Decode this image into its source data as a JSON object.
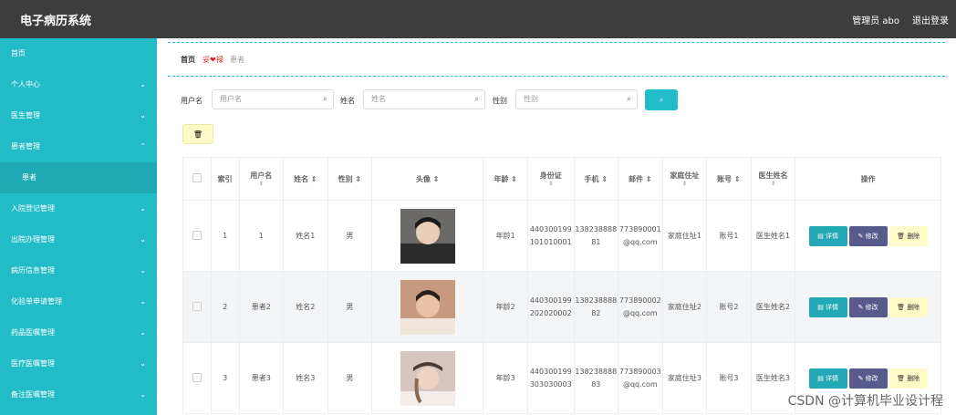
{
  "header": {
    "app_title": "电子病历系统",
    "admin_text": "管理员 abo",
    "logout_label": "退出登录"
  },
  "sidebar": {
    "items": [
      {
        "label": "首页"
      },
      {
        "label": "个人中心"
      },
      {
        "label": "医生管理"
      },
      {
        "label": "患者管理"
      },
      {
        "label": "患者"
      },
      {
        "label": "入院登记管理"
      },
      {
        "label": "出院办理管理"
      },
      {
        "label": "病历信息管理"
      },
      {
        "label": "化验单申请管理"
      },
      {
        "label": "药品医嘱管理"
      },
      {
        "label": "医疗医嘱管理"
      },
      {
        "label": "备注医嘱管理"
      }
    ]
  },
  "breadcrumb": {
    "home": "首页",
    "heart": "妥❤禄",
    "current": "患者"
  },
  "search": {
    "username_label": "用户名",
    "username_placeholder": "用户名",
    "name_label": "姓名",
    "name_placeholder": "姓名",
    "gender_label": "性别",
    "gender_placeholder": "性别"
  },
  "table": {
    "headers": {
      "index": "索引",
      "username": "用户名",
      "name": "姓名",
      "gender": "性别",
      "avatar": "头像",
      "age": "年龄",
      "idcard": "身份证",
      "phone": "手机",
      "email": "邮件",
      "address": "家庭住址",
      "account": "账号",
      "doctor": "医生姓名",
      "ops": "操作"
    },
    "rows": [
      {
        "index": "1",
        "username": "1",
        "name": "姓名1",
        "gender": "男",
        "age": "年龄1",
        "idcard": "440300199101010001",
        "phone": "13823888881",
        "email": "773890001@qq.com",
        "address": "家庭住址1",
        "account": "账号1",
        "doctor": "医生姓名1"
      },
      {
        "index": "2",
        "username": "患者2",
        "name": "姓名2",
        "gender": "男",
        "age": "年龄2",
        "idcard": "440300199202020002",
        "phone": "13823888882",
        "email": "773890002@qq.com",
        "address": "家庭住址2",
        "account": "账号2",
        "doctor": "医生姓名2"
      },
      {
        "index": "3",
        "username": "患者3",
        "name": "姓名3",
        "gender": "男",
        "age": "年龄3",
        "idcard": "440300199303030003",
        "phone": "13823888883",
        "email": "773890003@qq.com",
        "address": "家庭住址3",
        "account": "账号3",
        "doctor": "医生姓名3"
      }
    ],
    "ops": {
      "detail": "详情",
      "edit": "修改",
      "delete": "删除"
    }
  },
  "watermark": "CSDN @计算机毕业设计程",
  "colors": {
    "accent": "#22bcc9",
    "topbar": "#3d3d3d",
    "edit": "#585a8c",
    "delete_bg": "#fffbc8"
  }
}
